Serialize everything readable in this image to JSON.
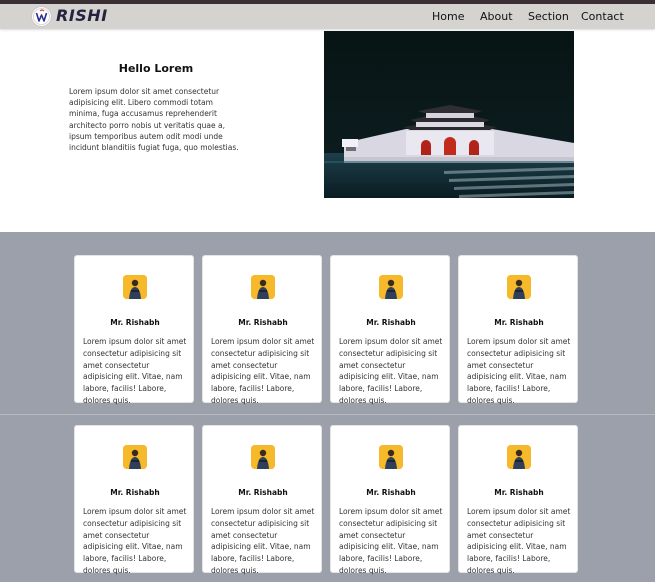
{
  "navbar": {
    "brand": "RISHI",
    "links": [
      "Home",
      "About",
      "Section",
      "Contact"
    ]
  },
  "hero": {
    "title": "Hello Lorem",
    "text": "Lorem ipsum dolor sit amet consectetur adipisicing elit. Libero commodi totam minima, fuga accusamus reprehenderit architecto porro nobis ut veritatis quae a, ipsum temporibus autem odit modi unde incidunt blanditiis fugiat fuga, quo molestias.",
    "image_icon": "palace-night-photo"
  },
  "cards": [
    {
      "name": "Mr. Rishabh",
      "text": "Lorem ipsum dolor sit amet consectetur adipisicing sit amet consectetur adipisicing elit. Vitae, nam labore, facilis! Labore, dolores quis."
    },
    {
      "name": "Mr. Rishabh",
      "text": "Lorem ipsum dolor sit amet consectetur adipisicing sit amet consectetur adipisicing elit. Vitae, nam labore, facilis! Labore, dolores quis."
    },
    {
      "name": "Mr. Rishabh",
      "text": "Lorem ipsum dolor sit amet consectetur adipisicing sit amet consectetur adipisicing elit. Vitae, nam labore, facilis! Labore, dolores quis."
    },
    {
      "name": "Mr. Rishabh",
      "text": "Lorem ipsum dolor sit amet consectetur adipisicing sit amet consectetur adipisicing elit. Vitae, nam labore, facilis! Labore, dolores quis."
    },
    {
      "name": "Mr. Rishabh",
      "text": "Lorem ipsum dolor sit amet consectetur adipisicing sit amet consectetur adipisicing elit. Vitae, nam labore, facilis! Labore, dolores quis."
    },
    {
      "name": "Mr. Rishabh",
      "text": "Lorem ipsum dolor sit amet consectetur adipisicing sit amet consectetur adipisicing elit. Vitae, nam labore, facilis! Labore, dolores quis."
    },
    {
      "name": "Mr. Rishabh",
      "text": "Lorem ipsum dolor sit amet consectetur adipisicing sit amet consectetur adipisicing elit. Vitae, nam labore, facilis! Labore, dolores quis."
    },
    {
      "name": "Mr. Rishabh",
      "text": "Lorem ipsum dolor sit amet consectetur adipisicing sit amet consectetur adipisicing elit. Vitae, nam labore, facilis! Labore, dolores quis."
    }
  ],
  "colors": {
    "navbar_bg": "#d5d3d0",
    "brand": "#232440",
    "section_bg": "#9ba0ab",
    "avatar_bg": "#f5b92a"
  }
}
